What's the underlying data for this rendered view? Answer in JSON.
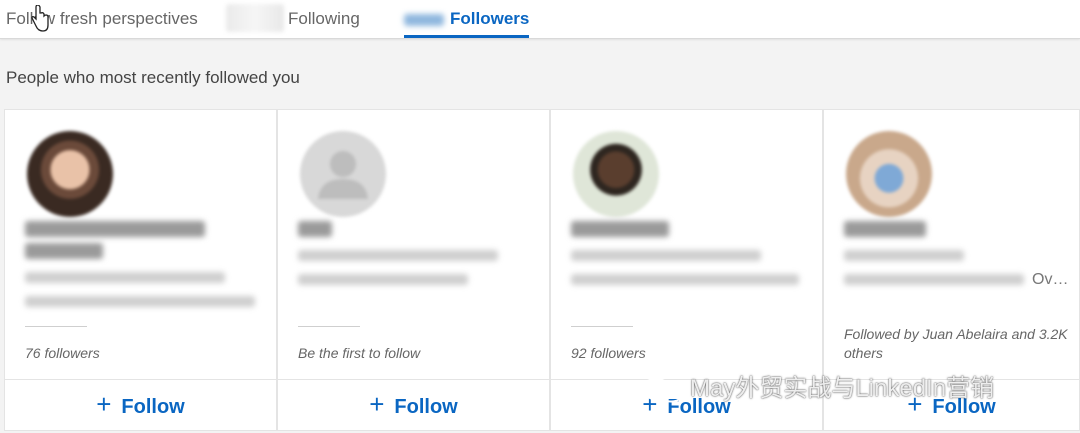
{
  "tabs": [
    {
      "label": "Follow fresh perspectives"
    },
    {
      "label": "Following"
    },
    {
      "label": "Followers"
    }
  ],
  "section_title": "People who most recently followed you",
  "cards": [
    {
      "meta": "76 followers",
      "follow_label": "Follow"
    },
    {
      "meta": "Be the first to follow",
      "follow_label": "Follow"
    },
    {
      "meta": "92 followers",
      "follow_label": "Follow"
    },
    {
      "meta": "Followed by Juan Abelaira and 3.2K others",
      "follow_label": "Follow",
      "overflow": "Ov…"
    }
  ],
  "watermark": "May外贸实战与LinkedIn营销",
  "colors": {
    "accent": "#0a66c2",
    "background": "#f3f3f3"
  }
}
